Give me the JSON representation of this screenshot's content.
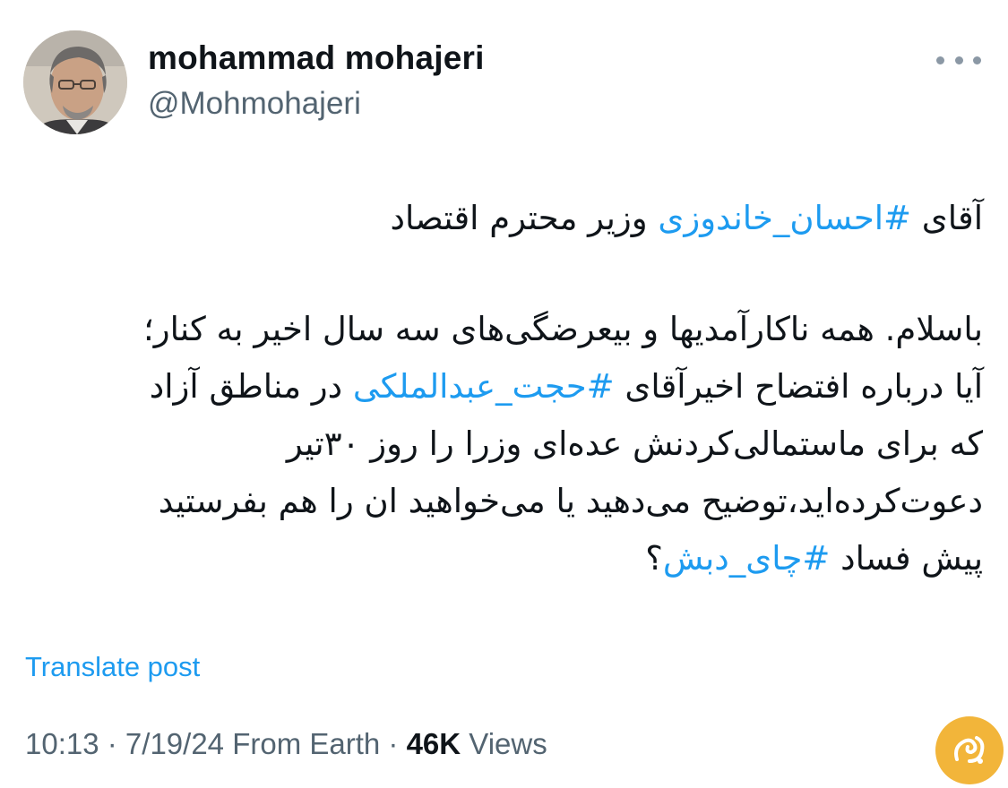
{
  "author": {
    "name": "mohammad mohajeri",
    "handle": "@Mohmohajeri"
  },
  "menu": {
    "icon": "more-horizontal-icon"
  },
  "post": {
    "line1": {
      "pre": "آقای ",
      "hashtag": "#احسان_خاندوزی",
      "post": " وزیر محترم اقتصاد"
    },
    "line2": "باسلام. همه ناکارآمدیها و بیعرضگی‌های سه سال اخیر به کنار؛",
    "line3": {
      "pre": "آیا درباره افتضاح اخیرآقای ",
      "hashtag": "#حجت_عبدالملکی",
      "post": " در مناطق آزاد"
    },
    "line4": "که برای ماستمالی‌کردنش عده‌ای وزرا را روز ۳۰تیر",
    "line5": "دعوت‌کرده‌اید،توضیح می‌دهید یا می‌خواهید ان را هم بفرستید",
    "line6": {
      "pre": "پیش فساد ",
      "hashtag": "#چای_دبش",
      "post": "؟"
    }
  },
  "translate_label": "Translate post",
  "meta": {
    "time": "10:13",
    "sep1": " · ",
    "date": "7/19/24",
    "source": " From Earth",
    "sep2": " · ",
    "views_count": "46K",
    "views_label": " Views"
  },
  "colors": {
    "link": "#1d9bf0",
    "secondary_text": "#536471",
    "primary_text": "#0f1419",
    "watermark": "#f2b53a"
  }
}
